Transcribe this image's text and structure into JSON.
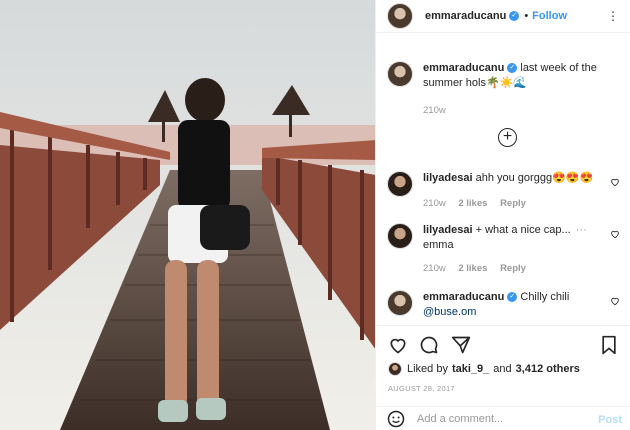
{
  "post": {
    "username": "emmaraducanu",
    "follow_label": "Follow",
    "separator": "•",
    "more_icon": "more-dots-icon"
  },
  "caption": {
    "username": "emmaraducanu",
    "text": "last week of the summer hols🌴☀️🌊",
    "time": "210w"
  },
  "comments": [
    {
      "username": "lilyadesai",
      "text": "ahh you gorggg😍😍😍",
      "time": "210w",
      "likes": "2 likes",
      "reply": "Reply"
    },
    {
      "username": "lilyadesai",
      "text": "+ what a nice cap...",
      "text2": "emma",
      "time": "210w",
      "likes": "2 likes",
      "reply": "Reply",
      "more": "···"
    },
    {
      "username": "emmaraducanu",
      "text": "Chilly chili",
      "mention": "@buse.om"
    }
  ],
  "likes": {
    "prefix": "Liked by",
    "user": "taki_9_",
    "and": "and",
    "others": "3,412 others"
  },
  "date": "AUGUST 28, 2017",
  "add_comment": {
    "placeholder": "Add a comment...",
    "post_label": "Post"
  },
  "colors": {
    "accent": "#3897f0",
    "text": "#262626",
    "muted": "#999999"
  }
}
